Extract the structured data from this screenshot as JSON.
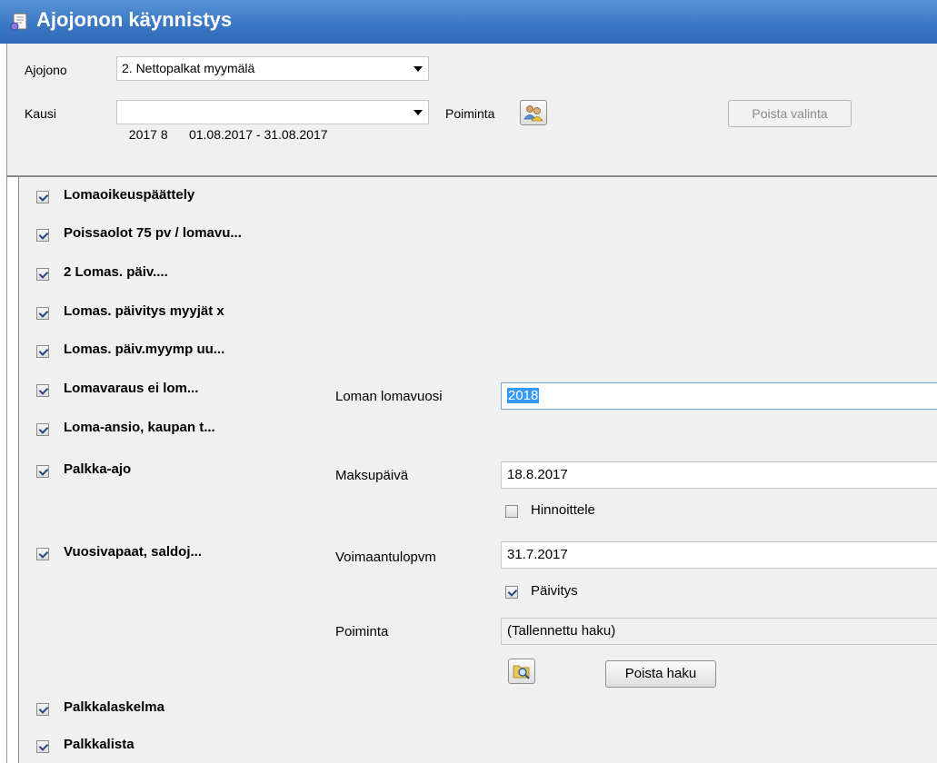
{
  "window": {
    "title": "Ajojonon käynnistys"
  },
  "form": {
    "queue_label": "Ajojono",
    "queue_value": "2. Nettopalkat myymälä",
    "period_label": "Kausi",
    "period_value": "2017 8      01.08.2017 - 31.08.2017",
    "selection_label": "Poiminta",
    "clear_selection_button": "Poista valinta"
  },
  "tasks": [
    {
      "label": "Lomaoikeuspäättely",
      "checked": true
    },
    {
      "label": "Poissaolot 75 pv / lomavu...",
      "checked": true
    },
    {
      "label": "2 Lomas. päiv....",
      "checked": true
    },
    {
      "label": "Lomas. päivitys myyjät x",
      "checked": true
    },
    {
      "label": "Lomas. päiv.myymp uu...",
      "checked": true
    },
    {
      "label": "Lomavaraus ei lom...",
      "checked": true
    },
    {
      "label": "Loma-ansio, kaupan t...",
      "checked": true
    },
    {
      "label": "Palkka-ajo",
      "checked": true
    },
    {
      "label": "Vuosivapaat, saldoj...",
      "checked": true
    },
    {
      "label": "Palkkalaskelma",
      "checked": true
    },
    {
      "label": "Palkkalista",
      "checked": true
    }
  ],
  "params": {
    "holiday_year_label": "Loman lomavuosi",
    "holiday_year_value": "2018",
    "payday_label": "Maksupäivä",
    "payday_value": "18.8.2017",
    "pricing_label": "Hinnoittele",
    "pricing_checked": false,
    "effective_date_label": "Voimaantulopvm",
    "effective_date_value": "31.7.2017",
    "update_label": "Päivitys",
    "update_checked": true,
    "selection_label": "Poiminta",
    "selection_value": "(Tallennettu haku)",
    "clear_search_button": "Poista haku"
  },
  "icons": {
    "window": "form-icon",
    "selection": "users-selection-icon",
    "search": "search-folder-icon"
  }
}
